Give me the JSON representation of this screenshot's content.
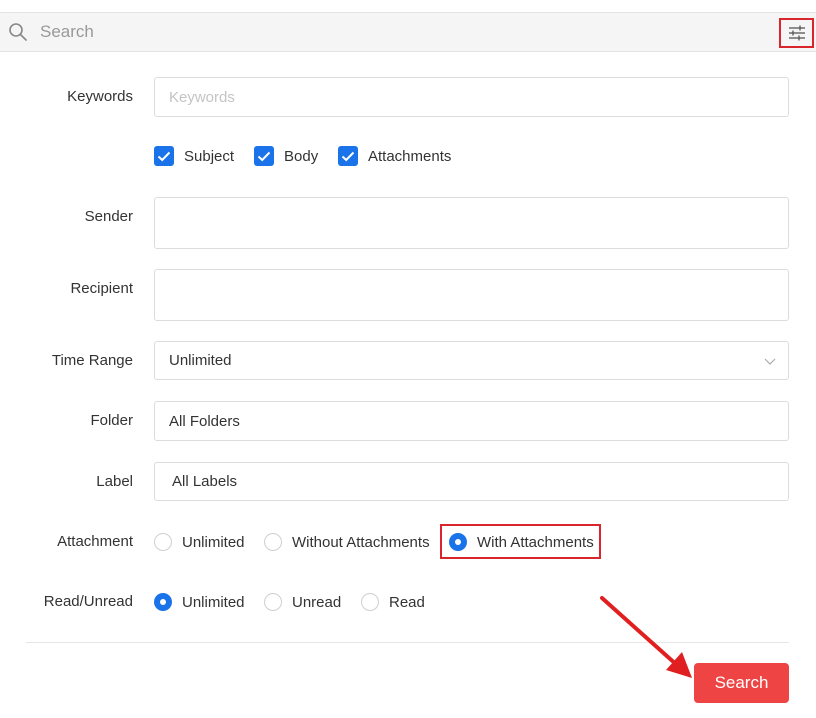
{
  "search": {
    "placeholder": "Search"
  },
  "form": {
    "keywords": {
      "label": "Keywords",
      "placeholder": "Keywords"
    },
    "scope": [
      {
        "label": "Subject",
        "checked": true
      },
      {
        "label": "Body",
        "checked": true
      },
      {
        "label": "Attachments",
        "checked": true
      }
    ],
    "sender": {
      "label": "Sender",
      "value": ""
    },
    "recipient": {
      "label": "Recipient",
      "value": ""
    },
    "time_range": {
      "label": "Time Range",
      "value": "Unlimited"
    },
    "folder": {
      "label": "Folder",
      "value": "All Folders"
    },
    "tag": {
      "label": "Label",
      "value": "All Labels"
    },
    "attachment": {
      "label": "Attachment",
      "options": [
        "Unlimited",
        "Without Attachments",
        "With Attachments"
      ],
      "selected": "With Attachments"
    },
    "read_status": {
      "label": "Read/Unread",
      "options": [
        "Unlimited",
        "Unread",
        "Read"
      ],
      "selected": "Unlimited"
    }
  },
  "actions": {
    "search_label": "Search"
  },
  "colors": {
    "accent": "#1a73e8",
    "primary_button": "#ee4444",
    "highlight": "#d9262c"
  }
}
